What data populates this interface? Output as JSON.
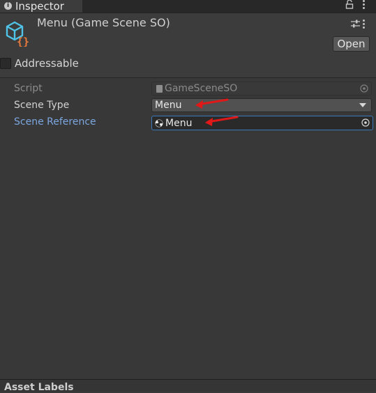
{
  "tab": {
    "label": "Inspector",
    "info_glyph": "i"
  },
  "header": {
    "title": "Menu (Game Scene SO)",
    "open_button": "Open",
    "addressable_label": "Addressable",
    "addressable_checked": false
  },
  "fields": {
    "script": {
      "label": "Script",
      "value": "GameSceneSO"
    },
    "scene_type": {
      "label": "Scene Type",
      "value": "Menu"
    },
    "scene_reference": {
      "label": "Scene Reference",
      "value": "Menu"
    }
  },
  "footer": {
    "label": "Asset Labels"
  },
  "colors": {
    "background": "#383838",
    "header": "#3c3c3c",
    "highlight_label": "#7ba6e0",
    "focus_border": "#3a79bb",
    "annotation_arrow": "#e01818",
    "icon_blue": "#4fc3e8",
    "icon_orange": "#e87a3c"
  },
  "icons": [
    "info-icon",
    "lock-icon",
    "kebab-menu-icon",
    "scriptable-object-icon",
    "preset-sliders-icon",
    "script-file-icon",
    "unity-scene-icon",
    "object-picker-icon",
    "dropdown-caret-icon"
  ]
}
